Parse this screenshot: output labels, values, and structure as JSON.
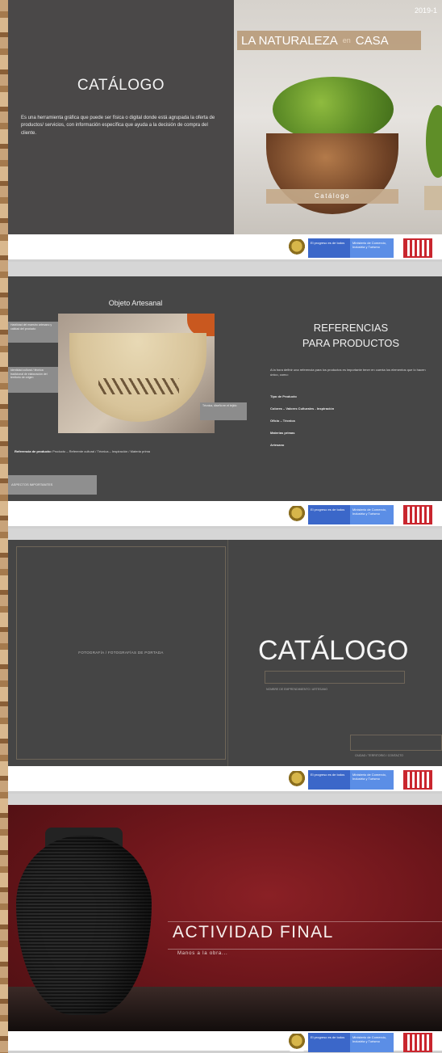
{
  "slide1": {
    "year": "2019-1",
    "banner_left": "LA NATURALEZA",
    "banner_mid": "en",
    "banner_right": "CASA",
    "title": "CATÁLOGO",
    "description": "Es una herramienta gráfica que puede ser física o digital donde está agrupada la oferta de productos/ servicios, con información específica que ayuda a la decisión de compra del cliente.",
    "label": "Catálogo"
  },
  "slide2": {
    "object_title": "Objeto Artesanal",
    "note1": "Habilidad del maestro artesano y calidad del producto",
    "note2": "Identidad cultural / técnica tradicional de elaboración del territorio de origen",
    "note3": "Técnica, diseño en el tejido",
    "ref_label": "Referencia de producto:",
    "ref_rest": "Producto – Referente cultural / Técnica – Inspiración / Materia prima",
    "heading_line1": "REFERENCIAS",
    "heading_line2": "PARA PRODUCTOS",
    "description": "A la hora definir una referencia para los productos es importante tener en cuenta los elementos que lo hacen único, como:",
    "items": [
      "Tipo de Producto",
      "Colores – Valores Culturales - Inspiración",
      "Oficio – Técnica",
      "Materias primas",
      "Artesano"
    ],
    "aspect_label": "ASPECTOS IMPORTANTES"
  },
  "slide3": {
    "frame_text": "FOTOGRAFÍA / FOTOGRAFÍAS DE PORTADA",
    "title": "CATÁLOGO",
    "sub1": "NOMBRE DE EMPRENDIMIENTO / ARTESANO",
    "sub2": "CIUDAD / TERRITORIO / CONTACTO"
  },
  "slide4": {
    "title": "ACTIVIDAD FINAL",
    "tagline": "Manos a la obra..."
  },
  "footer": {
    "gov_line1": "El progreso es de todos",
    "gov_line2": "Ministerio de Comercio, Industria y Turismo"
  },
  "colors": {
    "slide_dark": "#484646",
    "red_bg": "#6e161b",
    "gov_blue": "#3b67c9",
    "brand_red": "#c9262e"
  }
}
